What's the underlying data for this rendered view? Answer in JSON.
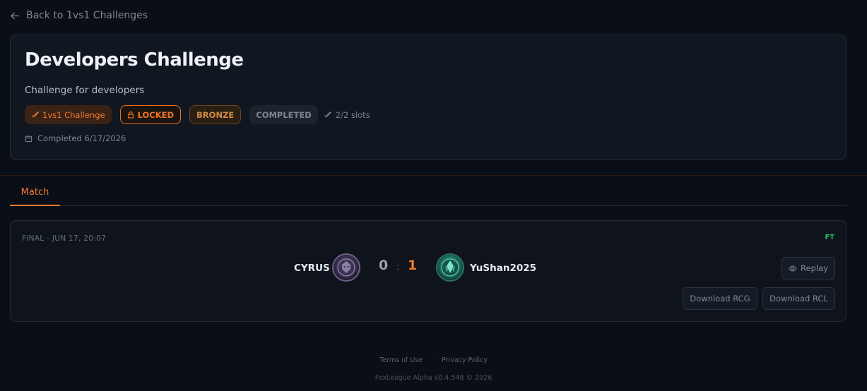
{
  "nav": {
    "back_label": "Back to 1vs1 Challenges"
  },
  "challenge": {
    "title": "Developers Challenge",
    "subtitle": "Challenge for developers",
    "badges": {
      "type": "1vs1 Challenge",
      "locked": "LOCKED",
      "tier": "BRONZE",
      "status": "COMPLETED"
    },
    "slots": "2/2 slots",
    "completed": "Completed 6/17/2026"
  },
  "tabs": [
    {
      "label": "Match"
    }
  ],
  "match": {
    "round": "FINAL - JUN 17, 20:07",
    "status": "FT",
    "home": {
      "name": "CYRUS",
      "score": "0",
      "avatar": "lion-crest-avatar"
    },
    "separator": ":",
    "away": {
      "name": "YuShan2025",
      "score": "1",
      "avatar": "teal-crest-avatar"
    },
    "buttons": {
      "replay": "Replay",
      "download_rcg": "Download RCG",
      "download_rcl": "Download RCL"
    }
  },
  "footer": {
    "terms": "Terms of Use",
    "dot": "·",
    "privacy": "Privacy Policy",
    "version": "FoxLeague Alpha v0.4.548 © 2026"
  },
  "colors": {
    "accent": "#f07a2e",
    "ft_green": "#1fbf5a",
    "background": "#0a0e16"
  }
}
